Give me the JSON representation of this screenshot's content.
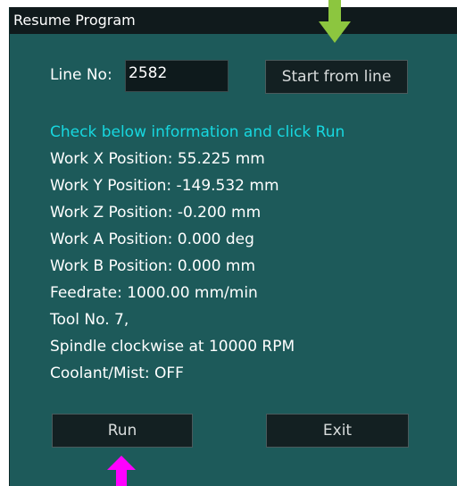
{
  "window": {
    "title": "Resume Program"
  },
  "line": {
    "label": "Line No:",
    "value": "2582"
  },
  "buttons": {
    "start_from_line": "Start from line",
    "run": "Run",
    "exit": "Exit"
  },
  "info": {
    "heading": "Check below information and click Run",
    "lines": [
      "Work X Position: 55.225 mm",
      "Work Y Position: -149.532 mm",
      "Work Z Position: -0.200 mm",
      "Work A Position:  0.000 deg",
      "Work B Position:  0.000 mm",
      "Feedrate: 1000.00 mm/min",
      "Tool No. 7,",
      "Spindle clockwise at 10000 RPM",
      "Coolant/Mist: OFF"
    ]
  },
  "colors": {
    "panel": "#1d5a5a",
    "heading": "#17d8e0",
    "arrow_green": "#8cc63f",
    "arrow_magenta": "#ff00ff"
  },
  "icons": {
    "green_arrow": "down-arrow-icon",
    "magenta_arrow": "up-arrow-icon"
  }
}
